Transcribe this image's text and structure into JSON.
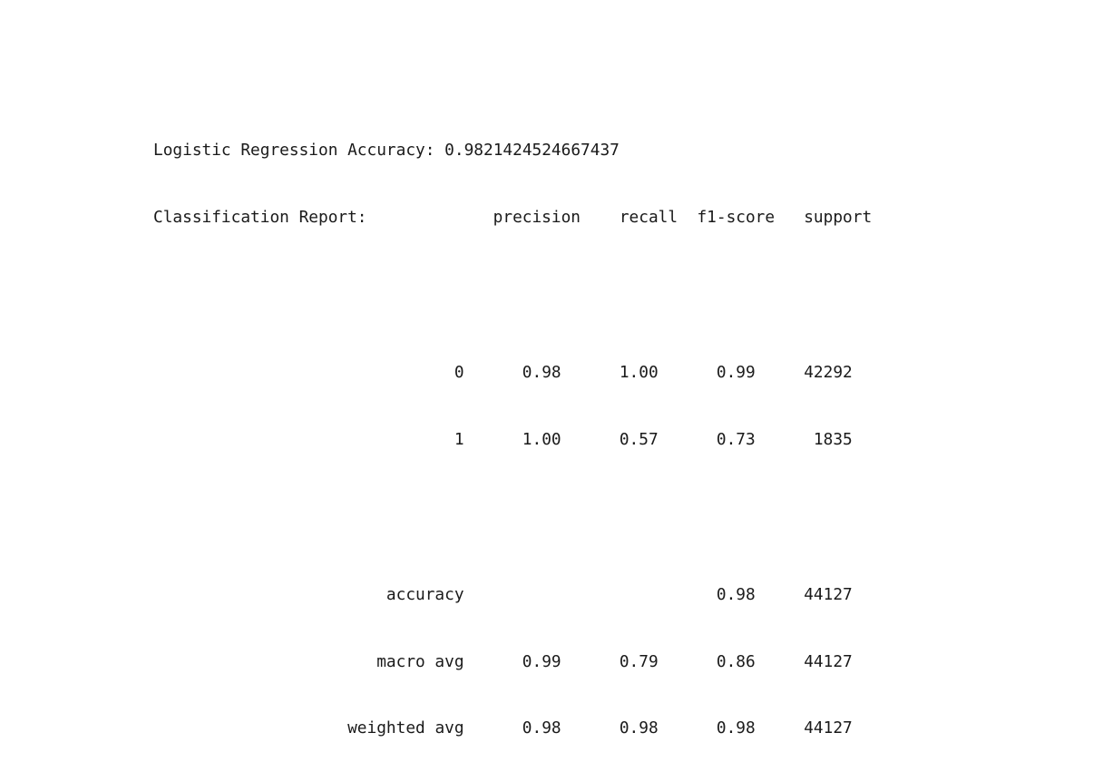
{
  "output": {
    "accuracy_line": {
      "label": "Logistic Regression Accuracy:",
      "value": "0.9821424524667437"
    },
    "report_title": "Classification Report:",
    "headers": [
      "precision",
      "recall",
      "f1-score",
      "support"
    ],
    "rows": [
      {
        "label": "0",
        "precision": "0.98",
        "recall": "1.00",
        "f1": "0.99",
        "support": "42292"
      },
      {
        "label": "1",
        "precision": "1.00",
        "recall": "0.57",
        "f1": "0.73",
        "support": "1835"
      }
    ],
    "summary": [
      {
        "label": "accuracy",
        "precision": "",
        "recall": "",
        "f1": "0.98",
        "support": "44127"
      },
      {
        "label": "macro avg",
        "precision": "0.99",
        "recall": "0.79",
        "f1": "0.86",
        "support": "44127"
      },
      {
        "label": "weighted avg",
        "precision": "0.98",
        "recall": "0.98",
        "f1": "0.98",
        "support": "44127"
      }
    ]
  }
}
